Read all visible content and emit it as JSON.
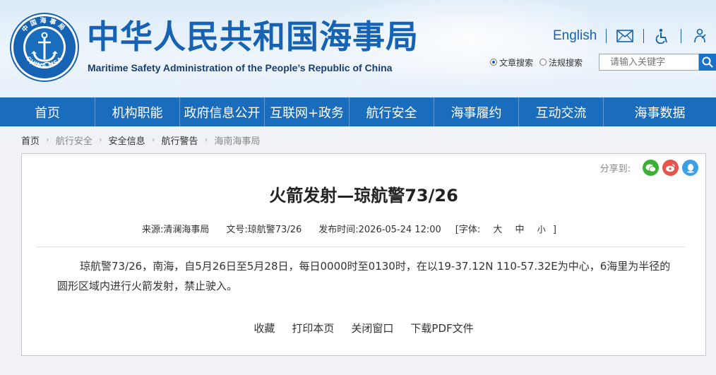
{
  "header": {
    "emblem_text_top": "中国海事局",
    "emblem_text_bottom": "CHINA MSA",
    "title": "中华人民共和国海事局",
    "subtitle": "Maritime Safety Administration of the People’s Republic of China",
    "lang_link": "English",
    "icons": [
      "mail-icon",
      "accessibility-icon",
      "elder-mode-icon"
    ],
    "search": {
      "options": [
        "文章搜索",
        "法规搜索"
      ],
      "selected": "文章搜索",
      "placeholder": "请输入关键字"
    }
  },
  "nav": [
    "首页",
    "机构职能",
    "政府信息公开",
    "互联网+政务",
    "航行安全",
    "海事履约",
    "互动交流",
    "海事数据"
  ],
  "breadcrumb": [
    "首页",
    "航行安全",
    "安全信息",
    "航行警告",
    "海南海事局"
  ],
  "article": {
    "share_label": "分享到:",
    "share_icons": [
      "wechat-icon",
      "weibo-icon",
      "qq-icon"
    ],
    "title": "火箭发射—琼航警73/26",
    "source": "来源:清澜海事局",
    "doc_no": "文号:琼航警73/26",
    "published": "发布时间:2026-05-24 12:00",
    "font_size_label": "[字体:",
    "font_sizes": [
      "大",
      "中",
      "小"
    ],
    "font_size_close": "]",
    "body": "琼航警73/26，南海，自5月26日至5月28日，每日0000时至0130时，在以19-37.12N 110-57.32E为中心，6海里为半径的圆形区域内进行火箭发射，禁止驶入。",
    "actions": [
      "收藏",
      "打印本页",
      "关闭窗口",
      "下载PDF文件"
    ]
  },
  "colors": {
    "brand_blue": "#1662b3",
    "nav_blue": "#1a6cbc",
    "wechat_green": "#3cb034",
    "weibo_red": "#e8534b",
    "qq_blue": "#3ba0e6"
  }
}
